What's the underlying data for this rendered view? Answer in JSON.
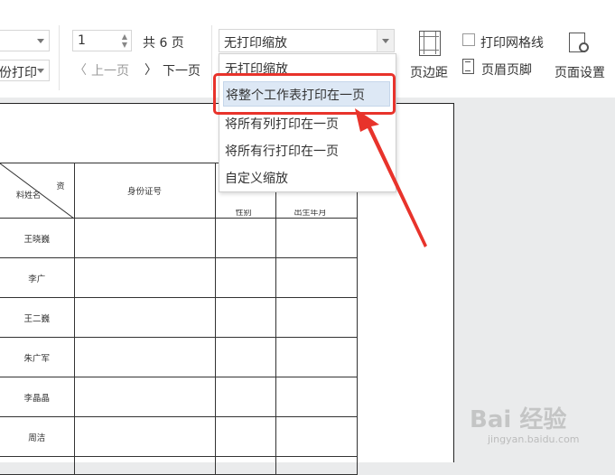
{
  "toolbar": {
    "page_input_value": "1",
    "page_total_label": "共 6 页",
    "prev_page_label": "上一页",
    "next_page_label": "下一页",
    "print_partial_label": "份打印",
    "scale_selected": "无打印缩放",
    "print_gridlines_label": "打印网格线",
    "margins_label": "页边距",
    "header_footer_label": "页眉页脚",
    "page_setup_label": "页面设置"
  },
  "dropdown": {
    "options": [
      "无打印缩放",
      "将整个工作表打印在一页",
      "将所有列打印在一页",
      "将所有行打印在一页",
      "自定义缩放"
    ],
    "highlighted_index": 1
  },
  "sheet": {
    "header_diag_top": "资",
    "header_diag_bottom": "料姓名",
    "col_headers": [
      "身份证号",
      "性别",
      "出生年月"
    ],
    "names": [
      "王晓巍",
      "李广",
      "王二巍",
      "朱广军",
      "李晶晶",
      "周洁"
    ]
  },
  "colors": {
    "highlight_border": "#e8332b",
    "arrow": "#e8332b",
    "selected_option_bg": "#dde8f5"
  },
  "watermark": {
    "brand": "Bai 经验",
    "url": "jingyan.baidu.com"
  }
}
